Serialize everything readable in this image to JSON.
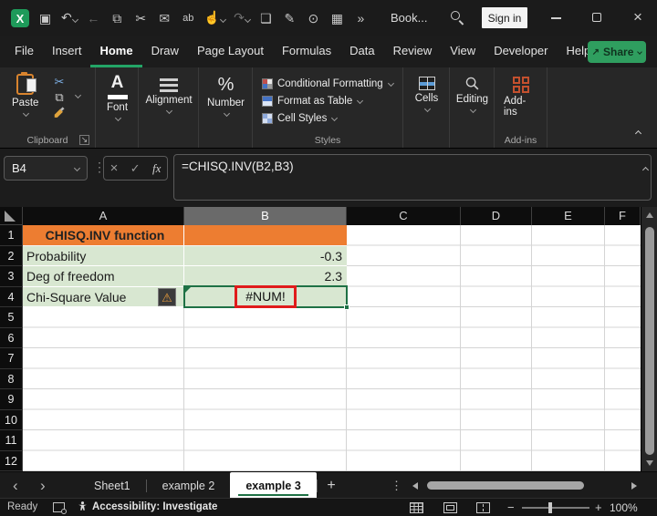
{
  "icons": {
    "excel_logo": "X",
    "save": "▣",
    "undo": "↶",
    "back": "←",
    "copy": "⧉",
    "cut": "✂",
    "email": "✉",
    "find_replace": "ab",
    "touch": "☝",
    "redo": "↷",
    "new_doc": "❏",
    "draw": "✎",
    "camera": "⊙",
    "form": "▦",
    "more": "»",
    "font_letter": "A",
    "percent": "%",
    "warning": "⚠",
    "dots": "⋮",
    "scissors": "✂",
    "copy_small": "⧉",
    "launcher": "↘",
    "prev_sheet": "‹",
    "next_sheet": "›",
    "add_sheet": "+",
    "sheet_more": "⋮",
    "close": "×",
    "minus": "−",
    "plus": "+",
    "share_arrow": "↗"
  },
  "titlebar": {
    "document_title": "Book...",
    "sign_in_label": "Sign in"
  },
  "ribbon": {
    "tabs": [
      {
        "label": "File"
      },
      {
        "label": "Insert"
      },
      {
        "label": "Home"
      },
      {
        "label": "Draw"
      },
      {
        "label": "Page Layout"
      },
      {
        "label": "Formulas"
      },
      {
        "label": "Data"
      },
      {
        "label": "Review"
      },
      {
        "label": "View"
      },
      {
        "label": "Developer"
      },
      {
        "label": "Help"
      }
    ],
    "share_label": "Share",
    "clipboard": {
      "paste_label": "Paste",
      "group_label": "Clipboard"
    },
    "font_label": "Font",
    "alignment_label": "Alignment",
    "number_label": "Number",
    "styles": {
      "conditional": "Conditional Formatting",
      "format_table": "Format as Table",
      "cell_styles": "Cell Styles",
      "group_label": "Styles"
    },
    "cells_label": "Cells",
    "editing_label": "Editing",
    "addins_label": "Add-ins",
    "addins_group_label": "Add-ins"
  },
  "formula_bar": {
    "name_box": "B4",
    "cancel": "×",
    "enter": "✓",
    "fx_label": "fx",
    "formula": "=CHISQ.INV(B2,B3)"
  },
  "grid": {
    "columns": [
      "A",
      "B",
      "C",
      "D",
      "E",
      "F"
    ],
    "row_numbers": [
      "1",
      "2",
      "3",
      "4",
      "5",
      "6",
      "7",
      "8",
      "9",
      "10",
      "11",
      "12"
    ],
    "cells": {
      "a1": "CHISQ.INV function",
      "a2": "Probability",
      "b2": "-0.3",
      "a3": "Deg of freedom",
      "b3": "2.3",
      "a4": "Chi-Square Value",
      "b4": "#NUM!"
    },
    "colors": {
      "header_fill": "#ED7D31",
      "data_fill": "#D8E7D1",
      "selection_border": "#1E7145",
      "error_annotation": "#E01B1B"
    }
  },
  "sheet_bar": {
    "tabs": [
      {
        "label": "Sheet1"
      },
      {
        "label": "example 2"
      },
      {
        "label": "example 3"
      }
    ]
  },
  "status_bar": {
    "ready_label": "Ready",
    "accessibility_label": "Accessibility: Investigate",
    "zoom_level": "100%"
  }
}
